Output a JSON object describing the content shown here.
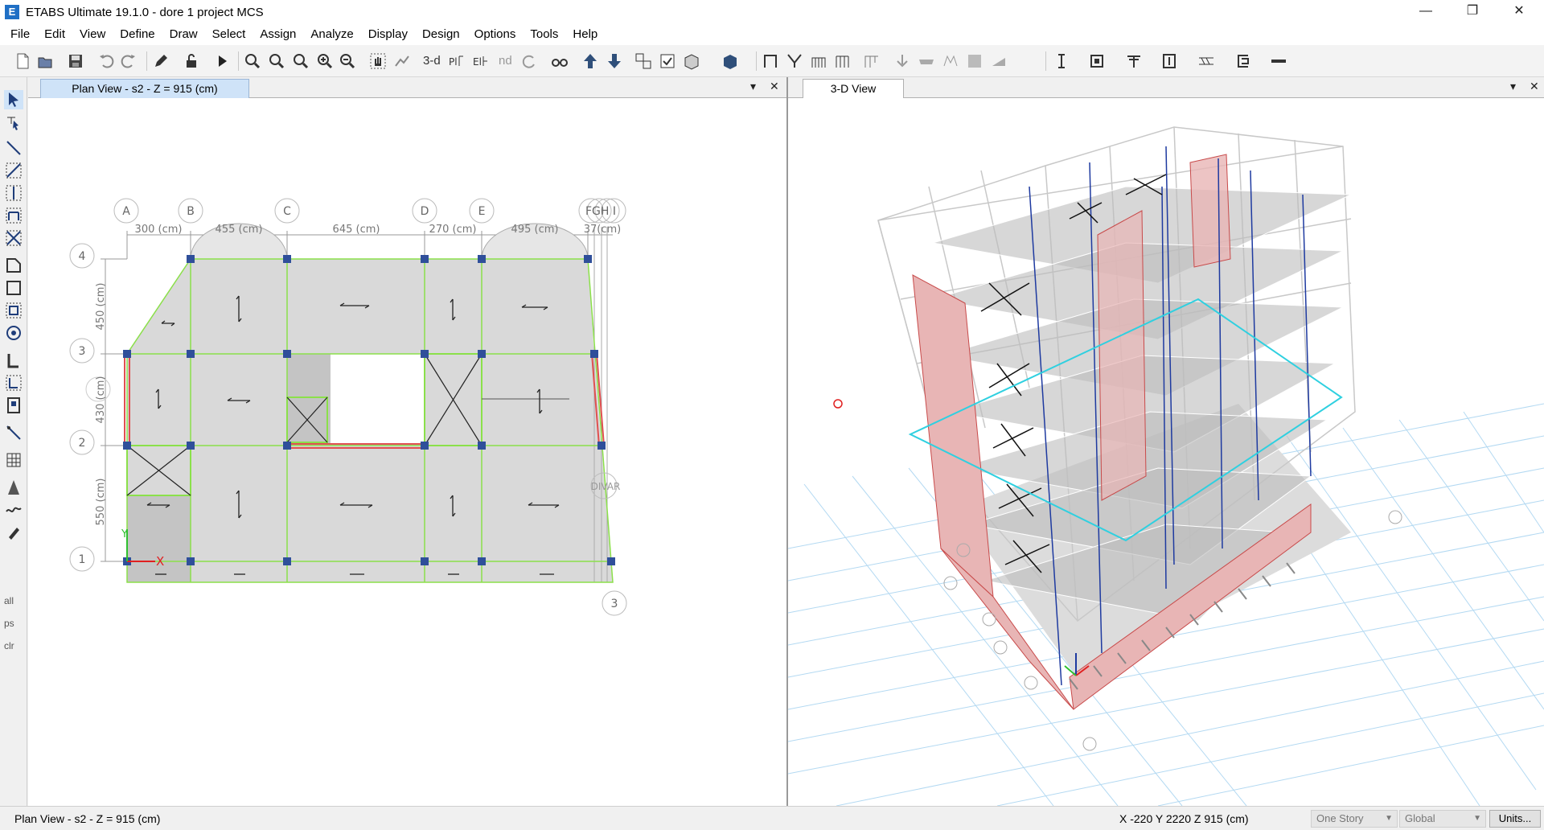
{
  "app": {
    "title": "ETABS Ultimate 19.1.0 - dore 1 project MCS",
    "icon": "E"
  },
  "window_controls": {
    "minimize": "—",
    "restore": "❐",
    "close": "✕"
  },
  "menu": [
    "File",
    "Edit",
    "View",
    "Define",
    "Draw",
    "Select",
    "Assign",
    "Analyze",
    "Display",
    "Design",
    "Options",
    "Tools",
    "Help"
  ],
  "toolbar": {
    "label_3d": "3-d",
    "label_plan": "Plan",
    "label_elev": "Elev",
    "label_nd": "nd"
  },
  "left_tools": {
    "all": "all",
    "ps": "ps",
    "clr": "clr"
  },
  "plan_view": {
    "tab_title": "Plan View - s2 - Z = 915 (cm)",
    "grid_x": [
      {
        "label": "A"
      },
      {
        "label": "B"
      },
      {
        "label": "C"
      },
      {
        "label": "D"
      },
      {
        "label": "E"
      },
      {
        "label": "FGH I"
      }
    ],
    "grid_y": [
      {
        "label": "4"
      },
      {
        "label": "3"
      },
      {
        "label": "2"
      },
      {
        "label": "1"
      }
    ],
    "dims_x": [
      "300 (cm)",
      "455 (cm)",
      "645 (cm)",
      "270 (cm)",
      "495 (cm)",
      "37(cm)"
    ],
    "dims_y": [
      "450 (cm)",
      "430 (cm)",
      "550 (cm)"
    ],
    "extra_bubble": "3",
    "divar_label": "DIVAR",
    "axis_x": "X",
    "axis_y": "Y"
  },
  "view3d": {
    "tab_title": "3-D View"
  },
  "pane_controls": {
    "dropdown": "▾",
    "close": "✕"
  },
  "status": {
    "left": "Plan View - s2 - Z = 915 (cm)",
    "coords": "X -220  Y 2220  Z 915 (cm)",
    "story_option": "One Story",
    "coord_system": "Global",
    "units_button": "Units..."
  },
  "colors": {
    "slab_fill": "#d9d9d9",
    "grid_green": "#8be04a",
    "beam_red": "#e05050",
    "joint_blue": "#2f4f9a",
    "bubble_gray": "#bdbdbd",
    "wall_red": "#c84a4a",
    "column_blue": "#1e3aa0",
    "floor_cyan": "#2fd0e0",
    "ground_grid": "#b3d9f2"
  }
}
